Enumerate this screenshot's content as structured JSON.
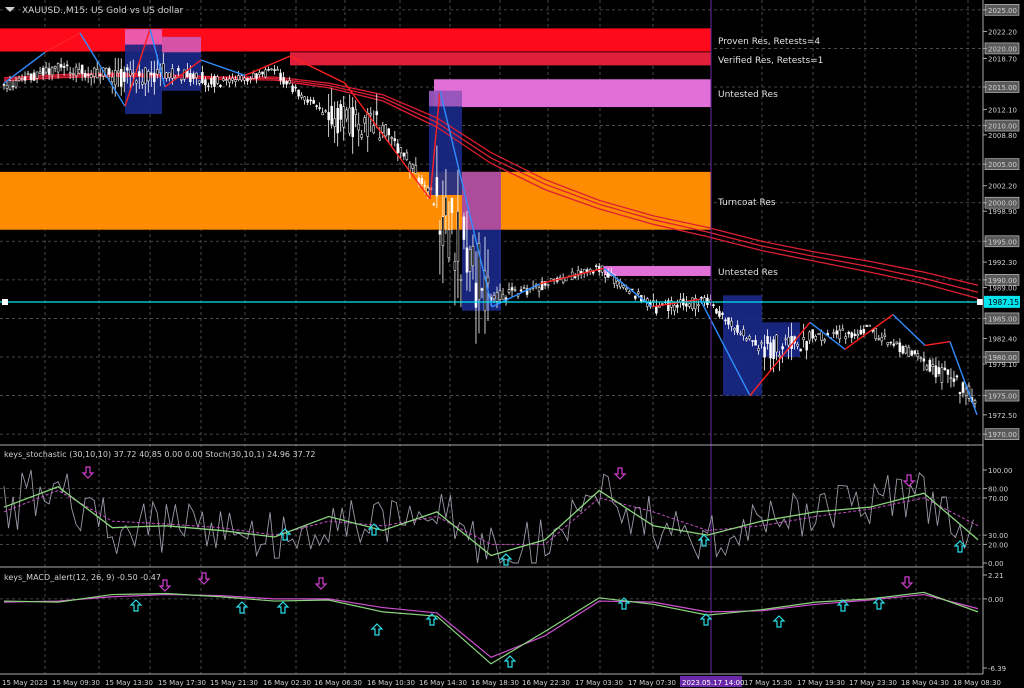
{
  "window": {
    "symbol_title": "XAUUSD.,M15: US Gold vs US dollar"
  },
  "colors": {
    "background": "#000000",
    "grid": "#5a5a5a",
    "axis_text": "#d0d0d0",
    "axis_line": "#aaaaaa",
    "price_line": "#00e5ee",
    "candle_up": "#ffffff",
    "candle_down": "#ffffff",
    "ma": "#dd1e34",
    "zigzag_red": "#ff2020",
    "zigzag_blue": "#2f8dff",
    "zone_proven": "#ff0a1a",
    "zone_verified": "#e0203a",
    "zone_untested": "#e070d8",
    "zone_turncoat": "#ff8c00",
    "box_blue": "#1a2a8a",
    "box_pink": "#ff5fb0",
    "stoch_main": "#8cd47e",
    "stoch_signal": "#c34ec4",
    "stoch_fast": "#9a9aa8",
    "macd_main": "#8cd47e",
    "macd_signal": "#d050d0",
    "arrow_up": "#2ae0e8",
    "arrow_down": "#d040d0",
    "vline": "#6a2aa8"
  },
  "price_axis": {
    "labels": [
      "2025.00",
      "2022.20",
      "2020.00",
      "2018.70",
      "2015.00",
      "2012.10",
      "2010.00",
      "2008.80",
      "2005.00",
      "2002.20",
      "2000.00",
      "1998.90",
      "1995.00",
      "1992.30",
      "1990.00",
      "1989.00",
      "1987.15",
      "1985.00",
      "1982.40",
      "1980.00",
      "1979.10",
      "1975.00",
      "1972.50",
      "1970.00"
    ],
    "highlighted": [
      "2025.00",
      "2020.00",
      "2015.00",
      "2010.00",
      "2005.00",
      "2000.00",
      "1995.00",
      "1990.00",
      "1985.00",
      "1980.00",
      "1975.00",
      "1970.00"
    ],
    "current_price": "1987.15"
  },
  "time_axis": {
    "labels": [
      "15 May 2023",
      "15 May 09:30",
      "15 May 13:30",
      "15 May 17:30",
      "15 May 21:30",
      "16 May 02:30",
      "16 May 06:30",
      "16 May 10:30",
      "16 May 14:30",
      "16 May 18:30",
      "16 May 22:30",
      "17 May 03:30",
      "17 May 07:30",
      "2023.05.17 14:00",
      "17 May 15:30",
      "17 May 19:30",
      "17 May 23:30",
      "18 May 04:30",
      "18 May 08:30"
    ],
    "cursor_label": "2023.05.17 14:00"
  },
  "zones": [
    {
      "label": "Proven Res, Retests=4",
      "kind": "proven"
    },
    {
      "label": "Verified Res, Retests=1",
      "kind": "verified"
    },
    {
      "label": "Untested Res",
      "kind": "untested"
    },
    {
      "label": "Turncoat Res",
      "kind": "turncoat"
    },
    {
      "label": "Untested Res",
      "kind": "untested"
    }
  ],
  "stochastic": {
    "title": "keys_stochastic (30,10,10) 37.72 40.85 0.00 0.00 Stoch(30,10,1) 24.96 37.72",
    "levels": [
      "100.00",
      "80.00",
      "70.00",
      "30.00",
      "20.00",
      "0.00"
    ]
  },
  "macd": {
    "title": "keys_MACD_alert(12, 26, 9) -0.50 -0.47",
    "levels": [
      "2.21",
      "0.00",
      "-6.39"
    ]
  },
  "chart_data": {
    "type": "candlestick",
    "title": "XAUUSD.,M15: US Gold vs US dollar",
    "y_range": [
      1969.5,
      2025.5
    ],
    "x": [
      "15 May 2023",
      "15 May 09:30",
      "15 May 13:30",
      "15 May 17:30",
      "15 May 21:30",
      "16 May 02:30",
      "16 May 06:30",
      "16 May 10:30",
      "16 May 14:30",
      "16 May 18:30",
      "16 May 22:30",
      "17 May 03:30",
      "17 May 07:30",
      "2023.05.17 14:00",
      "17 May 15:30",
      "17 May 19:30",
      "17 May 23:30",
      "18 May 04:30",
      "18 May 08:30"
    ],
    "close": [
      2015.0,
      2017.5,
      2016.5,
      2017.0,
      2015.5,
      2017.0,
      2011.0,
      2010.0,
      2000.0,
      1987.5,
      1989.5,
      1991.5,
      1986.5,
      1987.15,
      1981.0,
      1982.5,
      1983.5,
      1979.5,
      1974.5
    ],
    "high": [
      2016.5,
      2020.0,
      2022.0,
      2021.0,
      2017.5,
      2018.5,
      2017.5,
      2011.5,
      2013.5,
      1991.0,
      1991.5,
      1992.5,
      1989.5,
      1988.5,
      1985.5,
      1984.5,
      1985.5,
      1984.5,
      1980.5
    ],
    "low": [
      2012.5,
      2014.5,
      2013.0,
      2015.5,
      2014.5,
      2015.0,
      2006.0,
      2006.0,
      1987.0,
      1986.5,
      1988.5,
      1989.0,
      1984.5,
      1985.0,
      1976.5,
      1980.5,
      1981.5,
      1978.0,
      1972.5
    ],
    "ma_series": [
      {
        "values": [
          2016.2,
          2016.6,
          2016.8,
          2016.6,
          2016.3,
          2016.3,
          2015.5,
          2014.0,
          2011.0,
          2006.5,
          2003.0,
          2000.3,
          1998.3,
          1996.8,
          1995.0,
          1993.6,
          1992.4,
          1991.0,
          1989.3
        ]
      },
      {
        "values": [
          2016.0,
          2016.4,
          2016.6,
          2016.5,
          2016.2,
          2016.1,
          2015.2,
          2013.6,
          2010.4,
          2005.8,
          2002.4,
          1999.8,
          1997.8,
          1996.2,
          1994.4,
          1993.0,
          1991.7,
          1990.2,
          1988.4
        ]
      },
      {
        "values": [
          2015.8,
          2016.2,
          2016.4,
          2016.3,
          2016.0,
          2015.9,
          2014.9,
          2013.2,
          2009.8,
          2005.1,
          2001.7,
          1999.2,
          1997.2,
          1995.6,
          1993.8,
          1992.4,
          1991.0,
          1989.5,
          1987.6
        ]
      }
    ],
    "zones": [
      {
        "label": "Proven Res, Retests=4",
        "low": 2019.6,
        "high": 2022.6
      },
      {
        "label": "Verified Res, Retests=1",
        "low": 2017.8,
        "high": 2019.5
      },
      {
        "label": "Untested Res",
        "low": 2012.4,
        "high": 2016.0
      },
      {
        "label": "Turncoat Res",
        "low": 1996.5,
        "high": 2004.0
      },
      {
        "label": "Untested Res",
        "low": 1990.5,
        "high": 1991.8
      }
    ],
    "stochastic": {
      "main": [
        60,
        82,
        38,
        40,
        35,
        28,
        50,
        35,
        55,
        8,
        25,
        78,
        40,
        30,
        45,
        55,
        60,
        75,
        25
      ],
      "signal": [
        55,
        78,
        45,
        42,
        38,
        30,
        45,
        40,
        50,
        20,
        20,
        70,
        55,
        35,
        40,
        50,
        58,
        70,
        40
      ],
      "ylim": [
        0,
        100
      ]
    },
    "macd": {
      "main": [
        -0.2,
        -0.3,
        0.4,
        0.5,
        0.2,
        -0.2,
        -0.1,
        -1.2,
        -1.6,
        -6.0,
        -3.0,
        0.1,
        -0.5,
        -1.5,
        -1.0,
        -0.3,
        0.0,
        0.6,
        -1.2
      ],
      "signal": [
        -0.3,
        -0.2,
        0.2,
        0.4,
        0.3,
        0.0,
        0.0,
        -0.8,
        -1.3,
        -5.4,
        -3.4,
        -0.2,
        -0.3,
        -1.2,
        -1.1,
        -0.5,
        -0.1,
        0.4,
        -0.9
      ],
      "ylim": [
        -6.39,
        2.21
      ]
    }
  }
}
